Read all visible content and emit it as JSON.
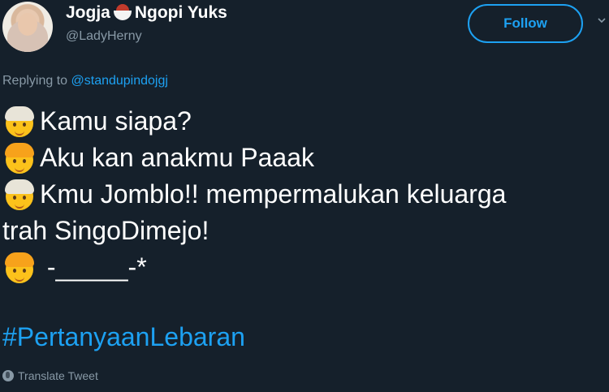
{
  "user": {
    "name_part1": "Jogja",
    "name_part2": "Ngopi Yuks",
    "handle": "@LadyHerny",
    "follow_label": "Follow"
  },
  "reply": {
    "prefix": "Replying to",
    "mention": "@standupindojgj"
  },
  "tweet": {
    "lines": [
      {
        "emoji": "old-man-face-icon",
        "text": "Kamu siapa?"
      },
      {
        "emoji": "child-face-icon",
        "text": "Aku kan anakmu Paaak"
      },
      {
        "emoji": "old-man-face-icon",
        "text": "Kmu Jomblo!! mempermalukan keluarga"
      },
      {
        "emoji": "",
        "text": "trah SingoDimejo!"
      },
      {
        "emoji": "child-face-icon",
        "text": " -_____-*"
      }
    ],
    "hashtag": "#PertanyaanLebaran"
  },
  "footer": {
    "translate_label": "Translate Tweet"
  },
  "colors": {
    "background": "#15202b",
    "accent": "#1da1f2",
    "muted": "#8899a6"
  }
}
